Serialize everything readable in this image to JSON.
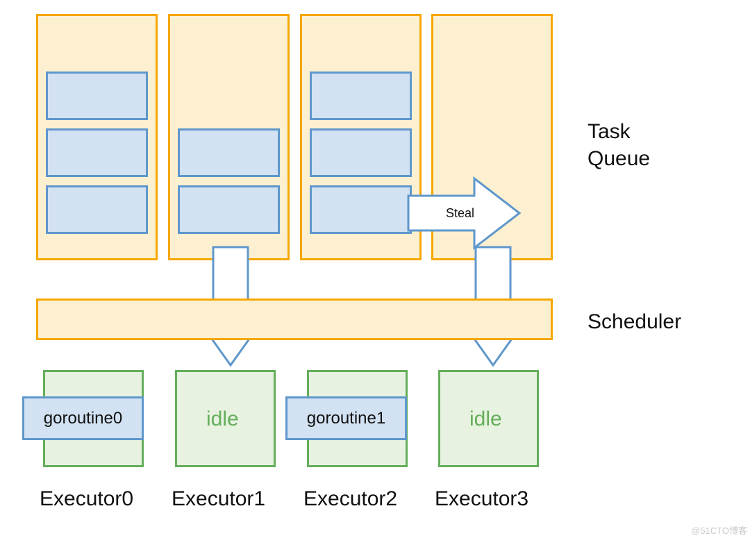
{
  "side_labels": {
    "task_queue_l1": "Task",
    "task_queue_l2": "Queue",
    "scheduler": "Scheduler"
  },
  "queues": {
    "q0_tasks": 3,
    "q1_tasks": 2,
    "q2_tasks": 3,
    "q3_tasks": 0
  },
  "steal_label": "Steal",
  "executors": {
    "e0": {
      "label": "Executor0",
      "state": "goroutine0",
      "idle": false
    },
    "e1": {
      "label": "Executor1",
      "state": "idle",
      "idle": true
    },
    "e2": {
      "label": "Executor2",
      "state": "goroutine1",
      "idle": false
    },
    "e3": {
      "label": "Executor3",
      "state": "idle",
      "idle": true
    }
  },
  "watermark": "@51CTO博客",
  "colors": {
    "queue_fill": "#fdf0d1",
    "queue_border": "#f5a700",
    "task_fill": "#d2e2f3",
    "task_border": "#5f97cc",
    "exec_fill": "#e7f3e0",
    "exec_border": "#65ae5b",
    "arrow_border": "#5f97cc",
    "arrow_fill": "#ffffff"
  }
}
